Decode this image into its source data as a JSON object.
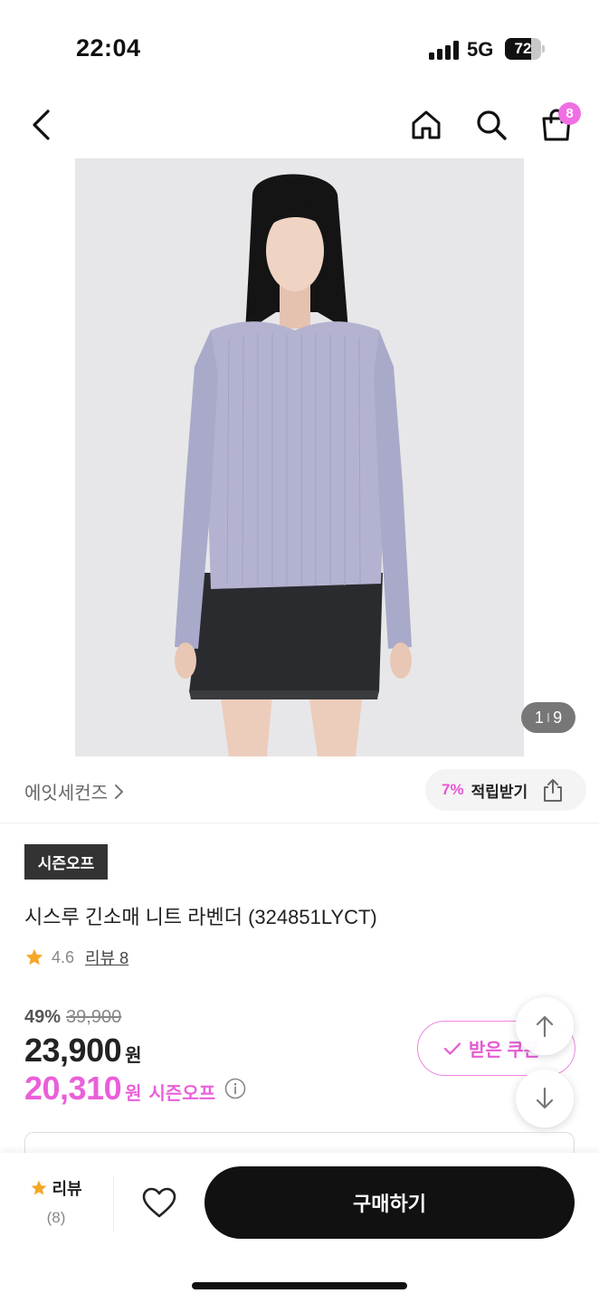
{
  "status_bar": {
    "time": "22:04",
    "network": "5G",
    "battery": "72",
    "battery_level": 0.72
  },
  "header": {
    "back_icon": "chevron-left-icon",
    "home_icon": "home-icon",
    "search_icon": "search-icon",
    "cart_icon": "shopping-bag-icon",
    "cart_count": "8"
  },
  "gallery": {
    "current": "1",
    "separator": "I",
    "total": "9"
  },
  "brand": {
    "name": "에잇세컨즈",
    "chevron": "›"
  },
  "points": {
    "percent": "7%",
    "label": "적립받기",
    "icon": "share-icon"
  },
  "product": {
    "tag": "시즌오프",
    "title": "시스루 긴소매 니트  라벤더 (324851LYCT)",
    "rating": "4.6",
    "review_link": "리뷰 8"
  },
  "price": {
    "discount_percent": "49%",
    "original": "39,900",
    "current": "23,900",
    "current_unit": "원",
    "sale": "20,310",
    "sale_unit": "원",
    "sale_label": "시즌오프"
  },
  "coupon": {
    "label": "받은 쿠폰",
    "icon": "check-icon"
  },
  "bottom_bar": {
    "review_label": "리뷰",
    "review_count": "(8)",
    "buy_label": "구매하기"
  },
  "colors": {
    "accent": "#ea5fd9",
    "badge": "#ef6fe2",
    "dark": "#111111",
    "star": "#f5a623"
  }
}
